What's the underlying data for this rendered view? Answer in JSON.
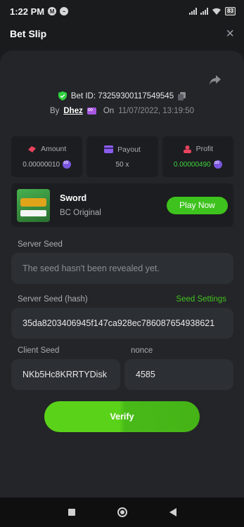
{
  "status_bar": {
    "time": "1:22 PM",
    "battery": "83"
  },
  "header": {
    "title": "Bet Slip",
    "close": "×"
  },
  "bet": {
    "id_label": "Bet ID: 73259300117549545",
    "by_label": "By",
    "user": "Dhez",
    "on_label": "On",
    "date": "11/07/2022, 13:19:50"
  },
  "stats": {
    "amount": {
      "label": "Amount",
      "value": "0.00000010"
    },
    "payout": {
      "label": "Payout",
      "value": "50 x"
    },
    "profit": {
      "label": "Profit",
      "value": "0.00000490"
    }
  },
  "game": {
    "name": "Sword",
    "subtitle": "BC Original",
    "play_label": "Play Now"
  },
  "server_seed": {
    "label": "Server Seed",
    "placeholder": "The seed hasn't been revealed yet."
  },
  "server_seed_hash": {
    "label": "Server Seed (hash)",
    "settings_label": "Seed Settings",
    "value": "35da8203406945f147ca928ec786087654938621"
  },
  "client_seed": {
    "label": "Client Seed",
    "value": "NKb5Hc8KRRTYDisk"
  },
  "nonce": {
    "label": "nonce",
    "value": "4585"
  },
  "verify_label": "Verify",
  "colors": {
    "accent_green": "#3ec21d",
    "background": "#1a1b1d",
    "card": "#232528",
    "profit_green": "#3fd33f",
    "coin_purple": "#7a56e0"
  }
}
